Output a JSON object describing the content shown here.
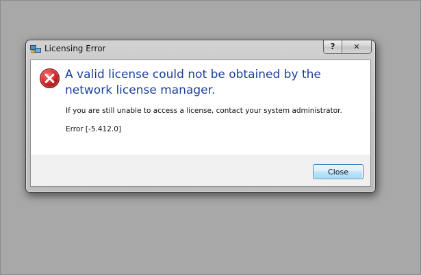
{
  "dialog": {
    "title": "Licensing Error",
    "help_label": "?",
    "close_label": "✕",
    "main_instruction": "A valid license could not be obtained by the network license manager.",
    "content": "If you are still unable to access a license, contact your system administrator.",
    "error_code": "Error [-5.412.0]",
    "close_button_label": "Close"
  },
  "icons": {
    "title_icon": "network-license-icon",
    "message_icon": "error-icon"
  },
  "colors": {
    "instruction_text": "#1a3f9a",
    "error_icon_red": "#d52b2b",
    "button_border": "#3c7fb1"
  }
}
